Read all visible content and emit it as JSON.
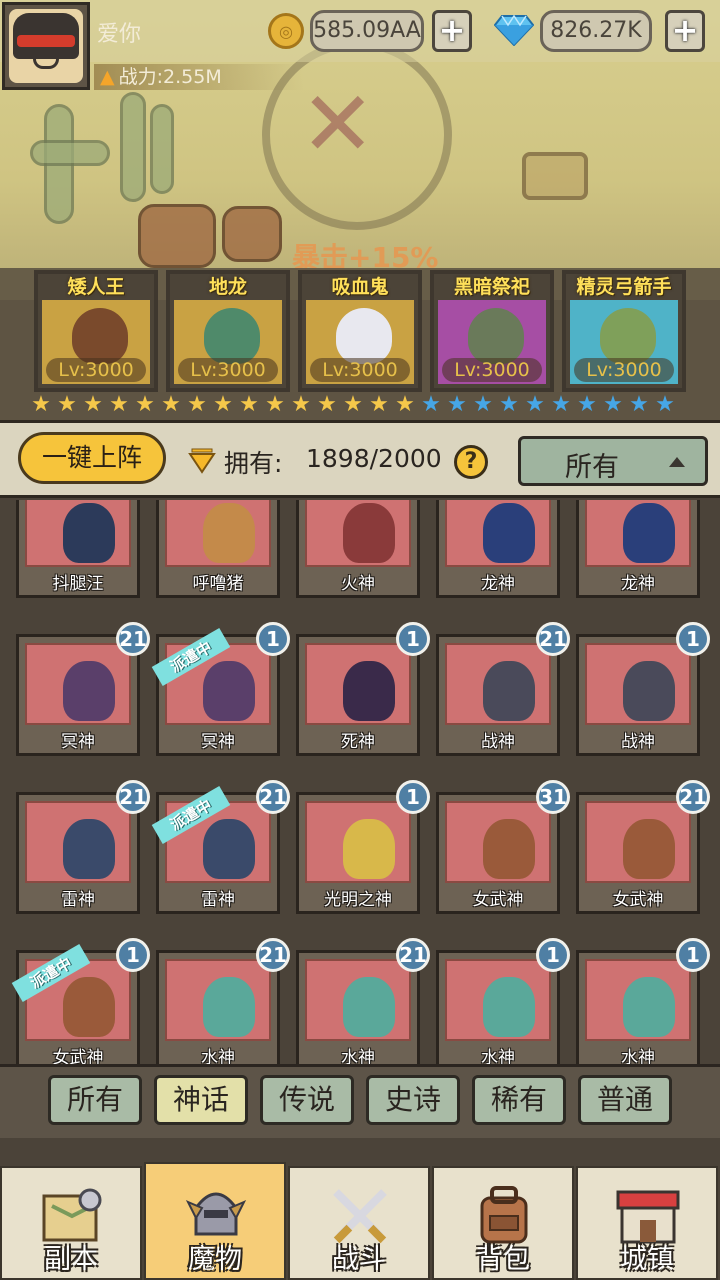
{
  "player": {
    "name": "爱你",
    "power": "战力:2.55M"
  },
  "resources": {
    "gold": "585.09AA",
    "gems": "826.27K",
    "plus": "+"
  },
  "scene": {
    "crit_text": "暴击+15%"
  },
  "team": [
    {
      "name": "矮人王",
      "level": "Lv:3000",
      "bg": "#c9a243",
      "fig": "#7a4a2c"
    },
    {
      "name": "地龙",
      "level": "Lv:3000",
      "bg": "#c9a243",
      "fig": "#4f8a6a"
    },
    {
      "name": "吸血鬼",
      "level": "Lv:3000",
      "bg": "#c9a243",
      "fig": "#e8e8ef"
    },
    {
      "name": "黑暗祭祀",
      "level": "Lv:3000",
      "bg": "#a64ea4",
      "fig": "#6a7a5a"
    },
    {
      "name": "精灵弓箭手",
      "level": "Lv:3000",
      "bg": "#4fb3c8",
      "fig": "#7fa05a"
    }
  ],
  "stars": {
    "gold_count": 15,
    "blue_count": 10,
    "gold_color": "#f5c84a",
    "blue_color": "#46a6e6"
  },
  "collection": {
    "deploy_label": "一键上阵",
    "owned_label": "拥有:",
    "owned_count": "1898/2000",
    "help": "?",
    "filter": "所有"
  },
  "monsters": [
    {
      "name": "抖腿汪",
      "badge": "",
      "dispatch": false,
      "fig": "#2c3a5a"
    },
    {
      "name": "呼噜猪",
      "badge": "",
      "dispatch": false,
      "fig": "#c48a4a"
    },
    {
      "name": "火神",
      "badge": "",
      "dispatch": false,
      "fig": "#8a3a3a"
    },
    {
      "name": "龙神",
      "badge": "",
      "dispatch": false,
      "fig": "#2a3f7a"
    },
    {
      "name": "龙神",
      "badge": "",
      "dispatch": false,
      "fig": "#2a3f7a"
    },
    {
      "name": "冥神",
      "badge": "21",
      "dispatch": false,
      "fig": "#5a3f6a"
    },
    {
      "name": "冥神",
      "badge": "1",
      "dispatch": true,
      "fig": "#5a3f6a"
    },
    {
      "name": "死神",
      "badge": "1",
      "dispatch": false,
      "fig": "#3a2a4a"
    },
    {
      "name": "战神",
      "badge": "21",
      "dispatch": false,
      "fig": "#4a4a5a"
    },
    {
      "name": "战神",
      "badge": "1",
      "dispatch": false,
      "fig": "#4a4a5a"
    },
    {
      "name": "雷神",
      "badge": "21",
      "dispatch": false,
      "fig": "#3a4a6a"
    },
    {
      "name": "雷神",
      "badge": "21",
      "dispatch": true,
      "fig": "#3a4a6a"
    },
    {
      "name": "光明之神",
      "badge": "1",
      "dispatch": false,
      "fig": "#d8b84a"
    },
    {
      "name": "女武神",
      "badge": "31",
      "dispatch": false,
      "fig": "#9a5a3a"
    },
    {
      "name": "女武神",
      "badge": "21",
      "dispatch": false,
      "fig": "#9a5a3a"
    },
    {
      "name": "女武神",
      "badge": "1",
      "dispatch": true,
      "fig": "#9a5a3a"
    },
    {
      "name": "水神",
      "badge": "21",
      "dispatch": false,
      "fig": "#5aa89a"
    },
    {
      "name": "水神",
      "badge": "21",
      "dispatch": false,
      "fig": "#5aa89a"
    },
    {
      "name": "水神",
      "badge": "1",
      "dispatch": false,
      "fig": "#5aa89a"
    },
    {
      "name": "水神",
      "badge": "1",
      "dispatch": false,
      "fig": "#5aa89a"
    }
  ],
  "dispatch_label": "派遣中",
  "rarity_tabs": [
    {
      "label": "所有",
      "active": false
    },
    {
      "label": "神话",
      "active": true
    },
    {
      "label": "传说",
      "active": false
    },
    {
      "label": "史诗",
      "active": false
    },
    {
      "label": "稀有",
      "active": false
    },
    {
      "label": "普通",
      "active": false
    }
  ],
  "nav": [
    {
      "label": "副本",
      "icon": "map-icon",
      "active": false
    },
    {
      "label": "魔物",
      "icon": "knight-helmet-icon",
      "active": true
    },
    {
      "label": "战斗",
      "icon": "crossed-swords-icon",
      "active": false
    },
    {
      "label": "背包",
      "icon": "backpack-icon",
      "active": false
    },
    {
      "label": "城镇",
      "icon": "shop-building-icon",
      "active": false
    }
  ]
}
